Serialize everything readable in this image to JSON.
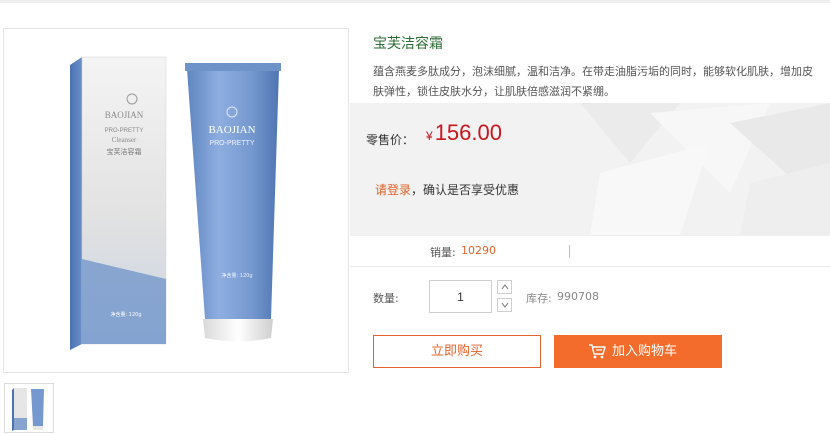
{
  "product": {
    "title": "宝芙洁容霜",
    "description": "蕴含燕麦多肽成分，泡沫细腻，温和洁净。在带走油脂污垢的同时，能够软化肌肤，增加皮肤弹性，锁住皮肤水分，让肌肤倍感滋润不紧绷。",
    "image_alt": "宝芙洁容霜产品图",
    "packaging": {
      "brand": "BAOJIAN",
      "line": "PRO-PRETTY",
      "type_en": "Cleanser",
      "name_cn": "宝芙洁容霜",
      "net_weight": "净含量: 120g"
    }
  },
  "price": {
    "label": "零售价：",
    "currency": "¥",
    "value": "156.00"
  },
  "login": {
    "link": "请登录",
    "hint": "，确认是否享受优惠"
  },
  "sales": {
    "label": "销量:",
    "value": "10290"
  },
  "quantity": {
    "label": "数量:",
    "value": "1",
    "stock_label": "库存:",
    "stock_value": "990708"
  },
  "actions": {
    "buy_now": "立即购买",
    "add_to_cart": "加入购物车"
  },
  "colors": {
    "accent": "#f36c2b",
    "price": "#c8161d",
    "title": "#2e6b36",
    "product_blue": "#6e93c9"
  }
}
